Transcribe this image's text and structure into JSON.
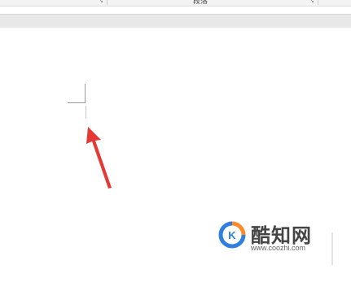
{
  "ribbon": {
    "group_label": "段落",
    "launcher_glyph": "↘"
  },
  "document": {
    "cursor": "text-cursor",
    "margin_marker": "margin-corner-mark"
  },
  "annotation": {
    "arrow_color": "#e53935",
    "arrow_icon": "red-arrow-icon"
  },
  "watermark": {
    "title": "酷知网",
    "url": "www.coozhi.com",
    "logo_icon": "coozhi-logo-icon",
    "logo_colors": [
      "#2f7fe0",
      "#ff8a2a"
    ]
  }
}
